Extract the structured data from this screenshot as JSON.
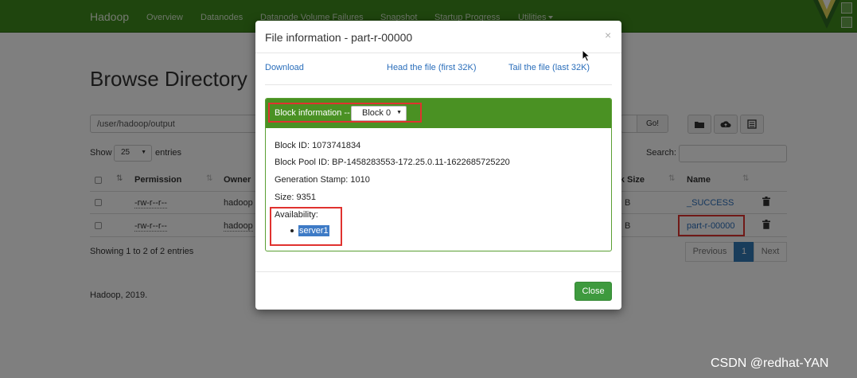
{
  "navbar": {
    "brand": "Hadoop",
    "items": [
      "Overview",
      "Datanodes",
      "Datanode Volume Failures",
      "Snapshot",
      "Startup Progress",
      "Utilities"
    ]
  },
  "page": {
    "title": "Browse Directory",
    "path_value": "/user/hadoop/output",
    "go_label": "Go!",
    "show_label": "Show",
    "show_value": "25",
    "entries_label": "entries",
    "search_label": "Search:",
    "columns": [
      "Permission",
      "Owner",
      "Block Size",
      "Name"
    ],
    "rows": [
      {
        "permission": "-rw-r--r--",
        "owner": "hadoop",
        "size_fragment": "B",
        "name": "_SUCCESS"
      },
      {
        "permission": "-rw-r--r--",
        "owner": "hadoop",
        "size_fragment": "B",
        "name": "part-r-00000"
      }
    ],
    "showing": "Showing 1 to 2 of 2 entries",
    "pager": {
      "previous": "Previous",
      "current": "1",
      "next": "Next"
    },
    "footer": "Hadoop, 2019."
  },
  "modal": {
    "title": "File information - part-r-00000",
    "close_icon": "×",
    "links": {
      "download": "Download",
      "head": "Head the file (first 32K)",
      "tail": "Tail the file (last 32K)"
    },
    "block_info_label": "Block information --",
    "block_select_value": "Block 0",
    "block_id": "Block ID: 1073741834",
    "block_pool_id": "Block Pool ID: BP-1458283553-172.25.0.11-1622685725220",
    "generation_stamp": "Generation Stamp: 1010",
    "size": "Size: 9351",
    "availability_label": "Availability:",
    "availability_nodes": [
      "server1"
    ],
    "close_button": "Close"
  },
  "watermark": "CSDN @redhat-YAN",
  "colors": {
    "navbar": "#3f8a1c",
    "panel_header": "#4a9123",
    "highlight_box": "#e0322f",
    "link": "#2a6ebb",
    "close_button": "#3e9a3e"
  }
}
